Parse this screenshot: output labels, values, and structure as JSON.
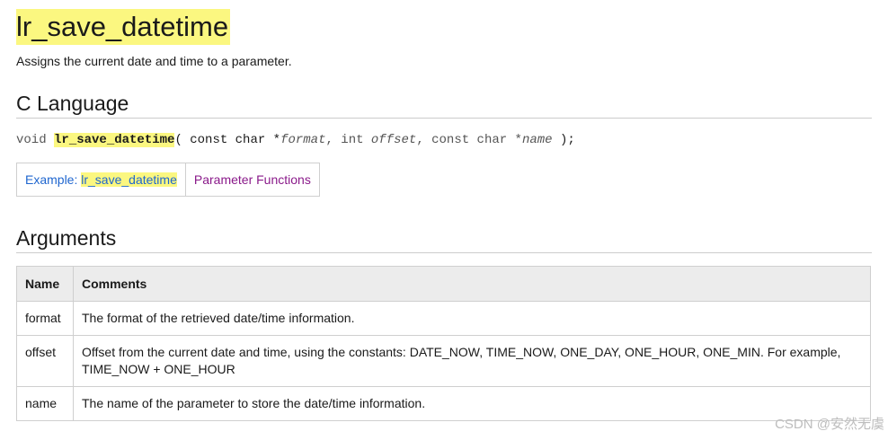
{
  "title": "lr_save_datetime",
  "subtitle": "Assigns the current date and time to a parameter.",
  "c_language": {
    "heading": "C Language",
    "syntax": {
      "return_type": "void ",
      "function": "lr_save_datetime",
      "open": "( const char *",
      "arg1": "format",
      "sep1": ", int ",
      "arg2": "offset",
      "sep2": ", const char *",
      "arg3": "name",
      "close": " );"
    }
  },
  "links": {
    "example_prefix": "Example: ",
    "example_name": "lr_save_datetime",
    "parameter_functions": "Parameter Functions"
  },
  "arguments": {
    "heading": "Arguments",
    "columns": [
      "Name",
      "Comments"
    ],
    "rows": [
      {
        "name": "format",
        "comment": "The format of the retrieved date/time information."
      },
      {
        "name": "offset",
        "comment": "Offset from the current date and time, using the constants: DATE_NOW, TIME_NOW, ONE_DAY, ONE_HOUR, ONE_MIN. For example, TIME_NOW + ONE_HOUR"
      },
      {
        "name": "name",
        "comment": "The name of the parameter to store the date/time information."
      }
    ]
  },
  "watermark": "CSDN @安然无虞"
}
